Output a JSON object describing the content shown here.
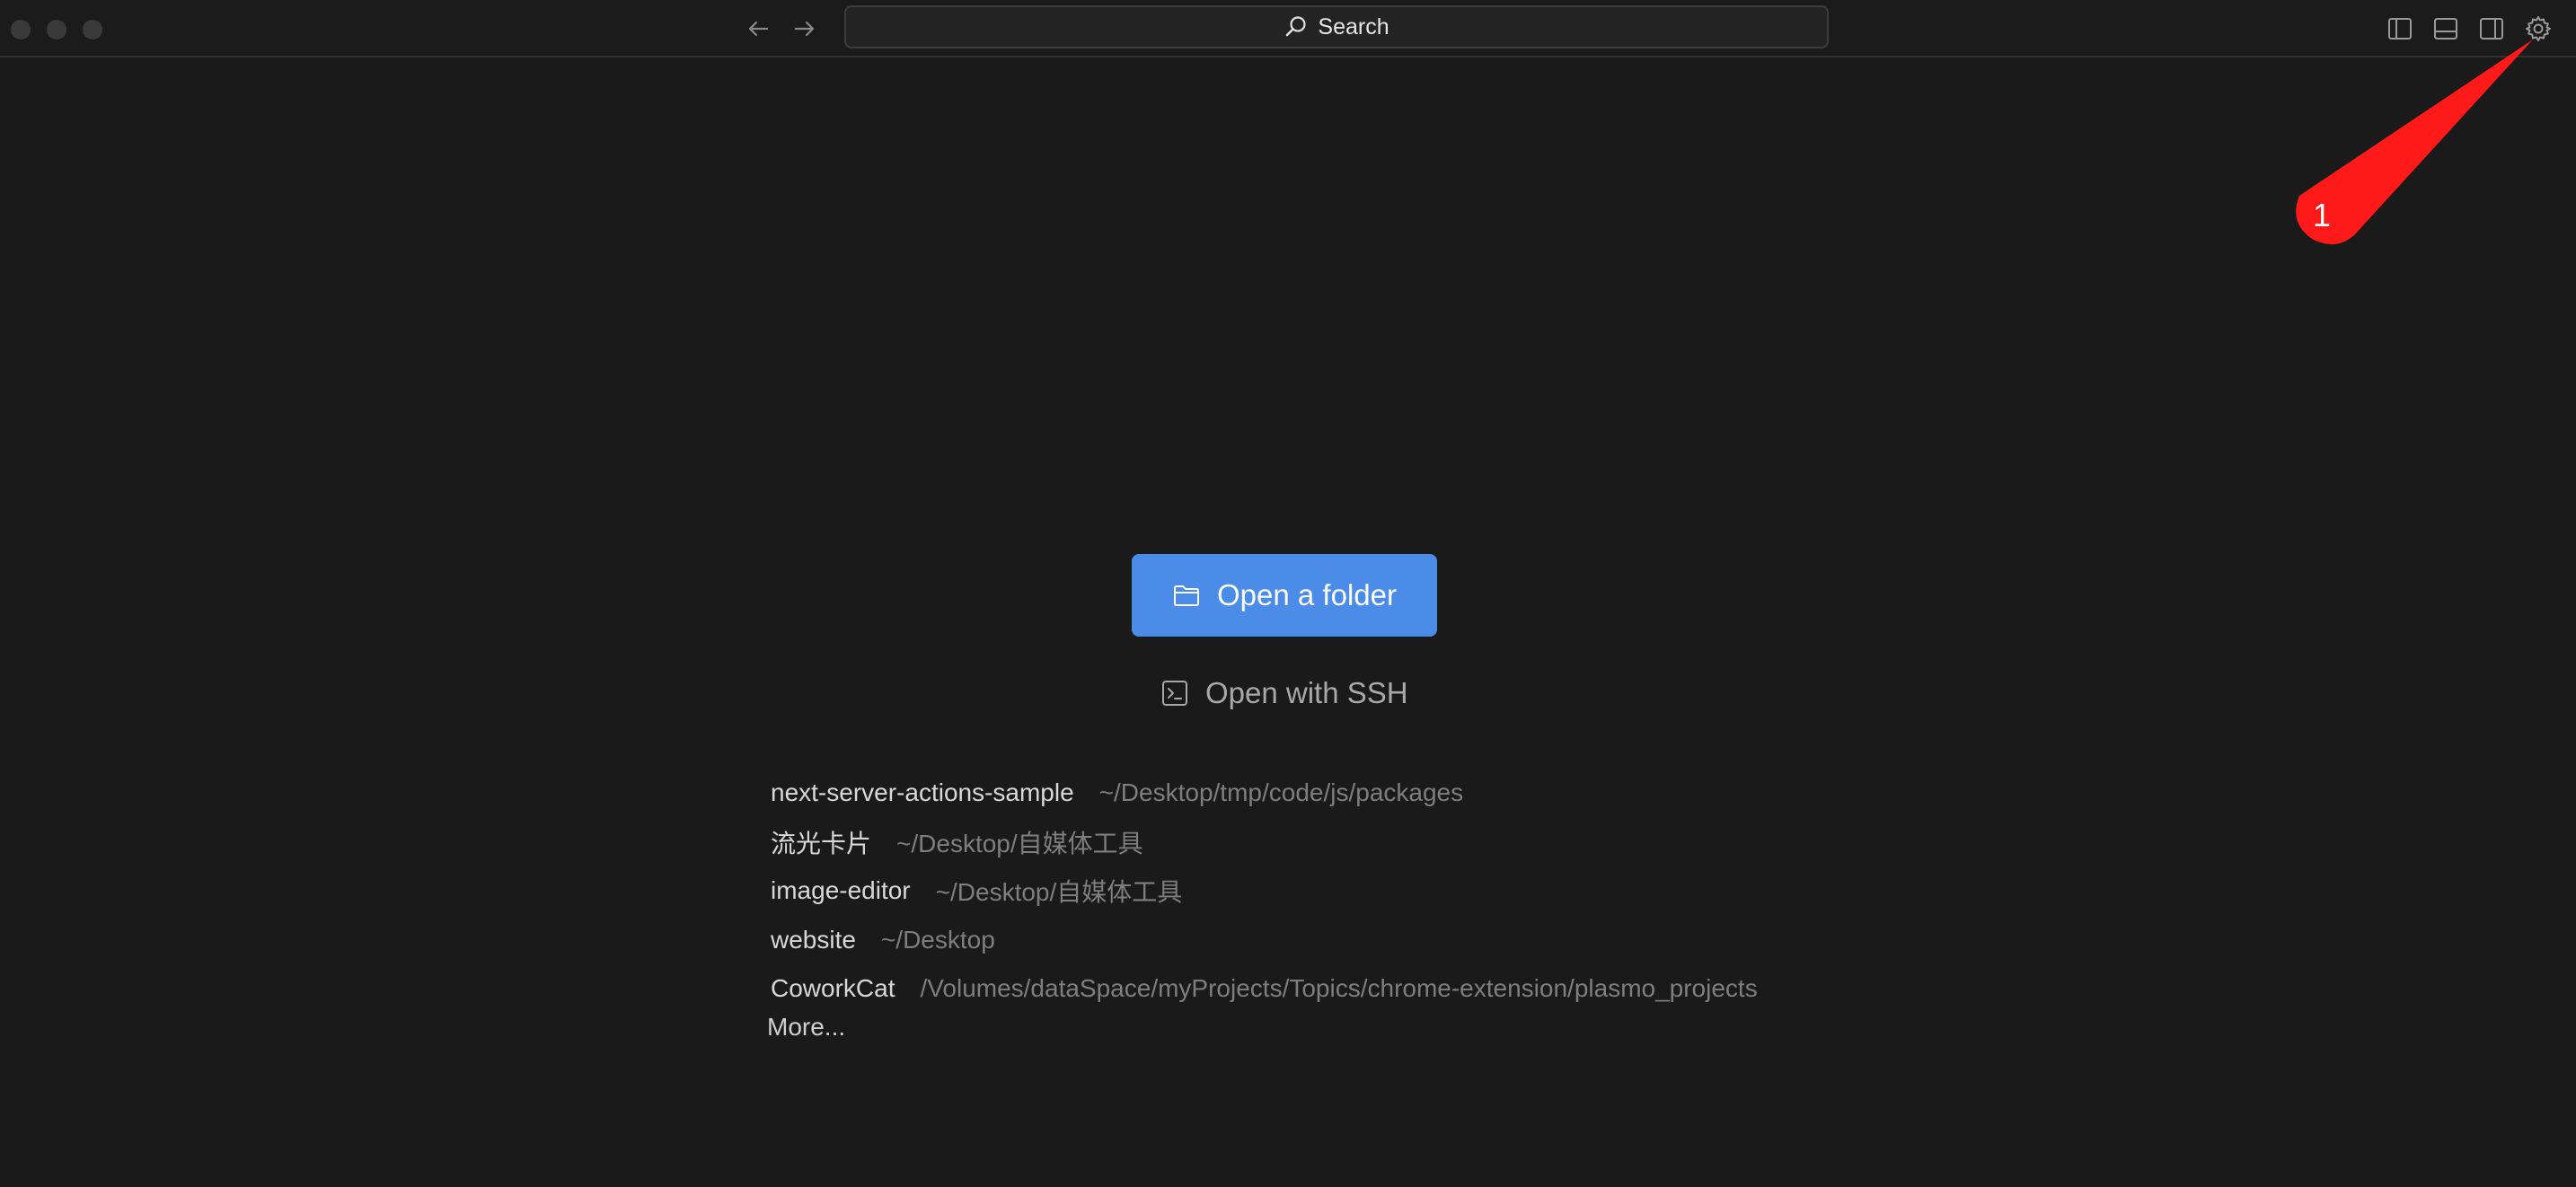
{
  "titlebar": {
    "search_label": "Search"
  },
  "main": {
    "open_folder_label": "Open a folder",
    "open_ssh_label": "Open with SSH",
    "recent": [
      {
        "name": "next-server-actions-sample",
        "path": "~/Desktop/tmp/code/js/packages"
      },
      {
        "name": "流光卡片",
        "path": "~/Desktop/自媒体工具"
      },
      {
        "name": "image-editor",
        "path": "~/Desktop/自媒体工具"
      },
      {
        "name": "website",
        "path": "~/Desktop"
      },
      {
        "name": "CoworkCat",
        "path": "/Volumes/dataSpace/myProjects/Topics/chrome-extension/plasmo_projects"
      }
    ],
    "more_label": "More..."
  },
  "annotation": {
    "marker_label": "1",
    "color": "#ff1a1a"
  },
  "colors": {
    "accent": "#4a8ce8",
    "background": "#1a1a1a"
  }
}
